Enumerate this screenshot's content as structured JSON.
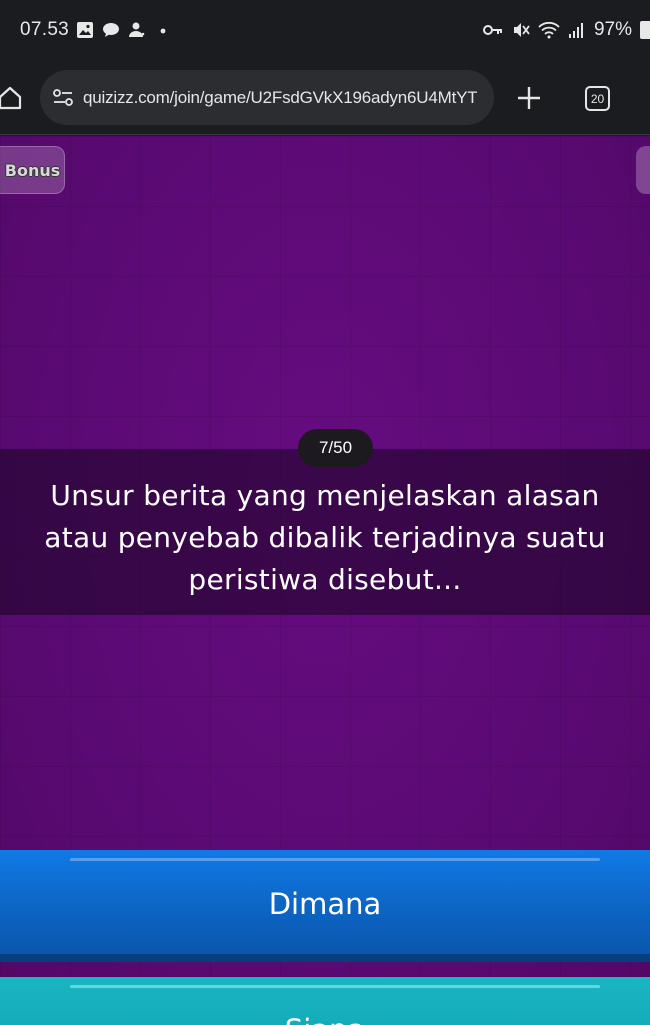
{
  "status_bar": {
    "time": "07.53",
    "battery": "97%",
    "left_icons": [
      "gallery-icon",
      "chat-icon",
      "person-icon",
      "dot-icon"
    ],
    "right_icons": [
      "vpn-key-icon",
      "mute-icon",
      "wifi-icon",
      "signal-icon",
      "battery-icon"
    ]
  },
  "browser": {
    "url": "quizizz.com/join/game/U2FsdGVkX196adyn6U4MtYT",
    "tab_count": "20"
  },
  "game": {
    "bonus_label": "Bonus",
    "progress": "7/50",
    "question": "Unsur berita yang menjelaskan alasan atau penyebab dibalik terjadinya suatu peristiwa disebut...",
    "answers": [
      {
        "label": "Dimana",
        "color": "#0d67c8"
      },
      {
        "label": "Siapa",
        "color": "#19b6c4"
      }
    ]
  },
  "colors": {
    "game_background": "#5a0a73",
    "status_bar": "#1b1c1f",
    "url_box": "#2c2d31"
  }
}
